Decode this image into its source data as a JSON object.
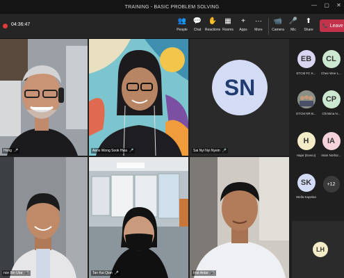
{
  "window": {
    "title": "TRAINING - BASIC PROBLEM SOLVING",
    "controls": [
      "—",
      "▢",
      "✕"
    ]
  },
  "toolbar": {
    "timer": "04:36:47",
    "items": [
      {
        "label": "People",
        "icon": "people-icon",
        "glyph": "👥"
      },
      {
        "label": "Chat",
        "icon": "chat-icon",
        "glyph": "💬"
      },
      {
        "label": "Reactions",
        "icon": "reactions-icon",
        "glyph": "✋"
      },
      {
        "label": "Rooms",
        "icon": "rooms-icon",
        "glyph": "▦"
      },
      {
        "label": "Apps",
        "icon": "apps-icon",
        "glyph": "+"
      },
      {
        "label": "More",
        "icon": "more-icon",
        "glyph": "···"
      },
      {
        "label": "Camera",
        "icon": "camera-icon",
        "glyph": "📹"
      },
      {
        "label": "Mic",
        "icon": "mic-icon",
        "glyph": "🎤"
      },
      {
        "label": "Share",
        "icon": "share-icon",
        "glyph": "⬆"
      }
    ],
    "leave": {
      "label": "Leave",
      "glyph": "📞"
    }
  },
  "video_tiles": [
    {
      "name": "Hong",
      "initials": ""
    },
    {
      "name": "Aens Wong Sook Hwa",
      "initials": ""
    },
    {
      "name": "Sai Nyi Nyi Nyein",
      "initials": "SN"
    },
    {
      "name": "nce Bin Utar",
      "initials": ""
    },
    {
      "name": "Tan Kai Qian",
      "initials": ""
    },
    {
      "name": "Irfat Antar",
      "initials": ""
    }
  ],
  "panel": {
    "participants": [
      {
        "initials": "EB",
        "name": "ETCM FC K...",
        "color": "#d9d4f0"
      },
      {
        "initials": "CL",
        "name": "Chee Wee L...",
        "color": "#cde8d0"
      },
      {
        "initials": "",
        "name": "ETCM NR B...",
        "color": "#b9b9b9"
      },
      {
        "initials": "CP",
        "name": "Christina N...",
        "color": "#cde8d0"
      },
      {
        "initials": "H",
        "name": "Hajar (Execu)",
        "color": "#f3ecc7"
      },
      {
        "initials": "IA",
        "name": "Intan Norfaz...",
        "color": "#f6d3dc"
      },
      {
        "initials": "SK",
        "name": "Stella Kapelan",
        "color": "#d3dcf4"
      }
    ],
    "more_count": "+12",
    "self_initials": "LH"
  }
}
